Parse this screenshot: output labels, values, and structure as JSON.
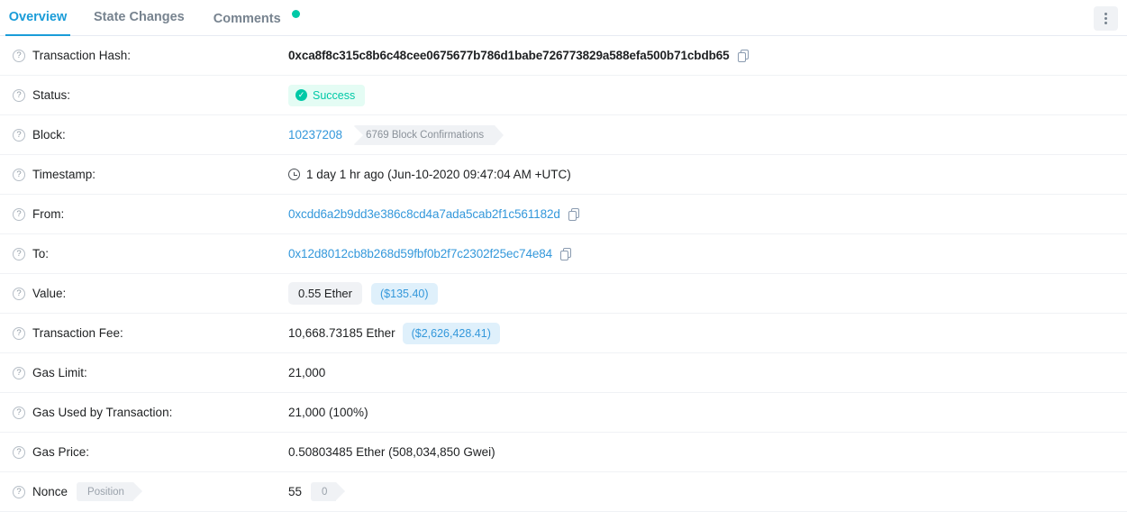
{
  "tabs": [
    {
      "id": "overview",
      "label": "Overview",
      "active": true
    },
    {
      "id": "state-changes",
      "label": "State Changes",
      "active": false
    },
    {
      "id": "comments",
      "label": "Comments",
      "active": false,
      "dot": true
    }
  ],
  "toolbar": {
    "menu_icon": "kebab-menu-icon"
  },
  "colors": {
    "accent": "#1a9cd8",
    "link": "#3498db",
    "success": "#00c9a7",
    "success_bg": "#e4fcf4",
    "tag_bg": "#f0f2f5",
    "usd_bg": "#dff0fb",
    "text": "#1e2022",
    "muted": "#77838f"
  },
  "rows": {
    "transaction_hash": {
      "label": "Transaction Hash:",
      "value": "0xca8f8c315c8b6c48cee0675677b786d1babe726773829a588efa500b71cbdb65",
      "copy_icon": "copy-icon"
    },
    "status": {
      "label": "Status:",
      "value": "Success",
      "icon": "check-circle-icon"
    },
    "block": {
      "label": "Block:",
      "value": "10237208",
      "confirmations": "6769 Block Confirmations"
    },
    "timestamp": {
      "label": "Timestamp:",
      "icon": "clock-icon",
      "value": "1 day 1 hr ago (Jun-10-2020 09:47:04 AM +UTC)"
    },
    "from": {
      "label": "From:",
      "value": "0xcdd6a2b9dd3e386c8cd4a7ada5cab2f1c561182d",
      "copy_icon": "copy-icon"
    },
    "to": {
      "label": "To:",
      "value": "0x12d8012cb8b268d59fbf0b2f7c2302f25ec74e84",
      "copy_icon": "copy-icon"
    },
    "value": {
      "label": "Value:",
      "ether": "0.55 Ether",
      "usd": "($135.40)"
    },
    "transaction_fee": {
      "label": "Transaction Fee:",
      "ether": "10,668.73185 Ether",
      "usd": "($2,626,428.41)"
    },
    "gas_limit": {
      "label": "Gas Limit:",
      "value": "21,000"
    },
    "gas_used": {
      "label": "Gas Used by Transaction:",
      "value": "21,000 (100%)"
    },
    "gas_price": {
      "label": "Gas Price:",
      "value": "0.50803485 Ether (508,034,850 Gwei)"
    },
    "nonce": {
      "label": "Nonce",
      "position_tag": "Position",
      "value": "55",
      "position_value": "0"
    }
  }
}
